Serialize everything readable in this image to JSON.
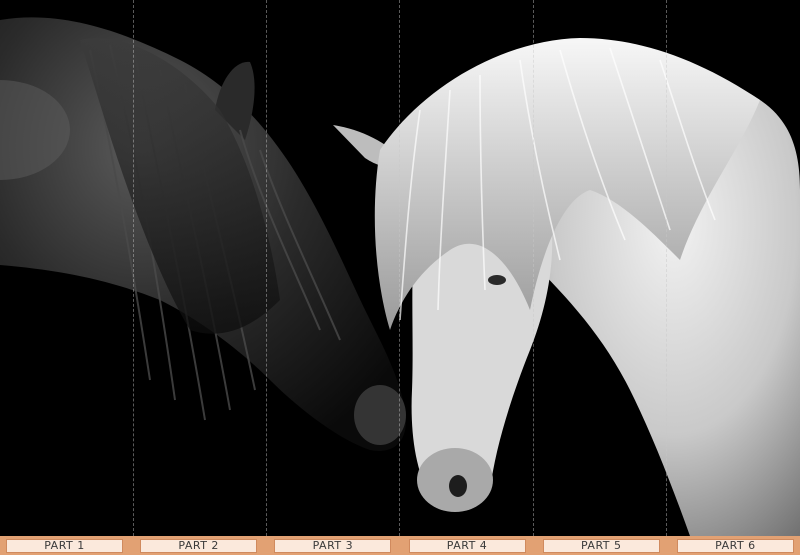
{
  "parts_bar": {
    "items": [
      {
        "label": "PART 1"
      },
      {
        "label": "PART 2"
      },
      {
        "label": "PART 3"
      },
      {
        "label": "PART 4"
      },
      {
        "label": "PART 5"
      },
      {
        "label": "PART 6"
      }
    ]
  },
  "colors": {
    "background": "#000000",
    "bar": "#e2a173",
    "button": "#fbe9dc",
    "button_border": "#d08a5e",
    "label": "#3b3b3b"
  }
}
